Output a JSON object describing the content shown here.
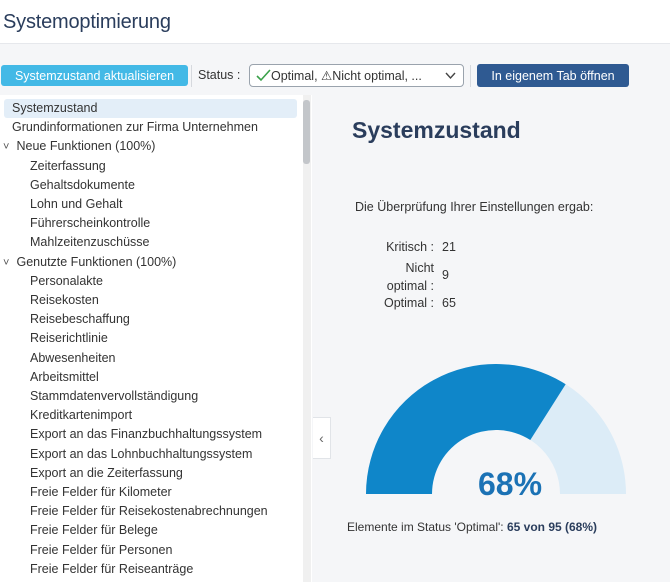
{
  "page": {
    "title": "Systemoptimierung"
  },
  "toolbar": {
    "refresh_label": "Systemzustand aktualisieren",
    "status_label": "Status :",
    "status_value": "Optimal, ⚠Nicht optimal, ...",
    "open_tab_label": "In eigenem Tab öffnen"
  },
  "sidebar": {
    "items": [
      {
        "label": "Systemzustand",
        "selected": true,
        "level": 0
      },
      {
        "label": "Grundinformationen zur Firma Unternehmen",
        "level": 0
      },
      {
        "label": "Neue Funktionen (100%)",
        "level": 0,
        "group": true
      },
      {
        "label": "Zeiterfassung",
        "level": 1
      },
      {
        "label": "Gehaltsdokumente",
        "level": 1
      },
      {
        "label": "Lohn und Gehalt",
        "level": 1
      },
      {
        "label": "Führerscheinkontrolle",
        "level": 1
      },
      {
        "label": "Mahlzeitenzuschüsse",
        "level": 1
      },
      {
        "label": "Genutzte Funktionen (100%)",
        "level": 0,
        "group": true
      },
      {
        "label": "Personalakte",
        "level": 1
      },
      {
        "label": "Reisekosten",
        "level": 1
      },
      {
        "label": "Reisebeschaffung",
        "level": 1
      },
      {
        "label": "Reiserichtlinie",
        "level": 1
      },
      {
        "label": "Abwesenheiten",
        "level": 1
      },
      {
        "label": "Arbeitsmittel",
        "level": 1
      },
      {
        "label": "Stammdatenvervollständigung",
        "level": 1
      },
      {
        "label": "Kreditkartenimport",
        "level": 1
      },
      {
        "label": "Export an das Finanzbuchhaltungssystem",
        "level": 1
      },
      {
        "label": "Export an das Lohnbuchhaltungssystem",
        "level": 1
      },
      {
        "label": "Export an die Zeiterfassung",
        "level": 1
      },
      {
        "label": "Freie Felder für Kilometer",
        "level": 1
      },
      {
        "label": "Freie Felder für Reisekostenabrechnungen",
        "level": 1
      },
      {
        "label": "Freie Felder für Belege",
        "level": 1
      },
      {
        "label": "Freie Felder für Personen",
        "level": 1
      },
      {
        "label": "Freie Felder für Reiseanträge",
        "level": 1
      }
    ]
  },
  "main": {
    "title": "Systemzustand",
    "intro": "Die Überprüfung Ihrer Einstellungen ergab:",
    "stats": [
      {
        "label": "Kritisch :",
        "value": "21"
      },
      {
        "label": "Nicht optimal :",
        "value": "9"
      },
      {
        "label": "Optimal :",
        "value": "65"
      }
    ],
    "gauge_percent_label": "68%",
    "gauge_fraction": 0.68,
    "summary_prefix": "Elemente im Status 'Optimal':",
    "summary_value": "65 von 95 (68%)"
  },
  "colors": {
    "gauge_fill": "#0f86c9",
    "gauge_track": "#dcecf7",
    "accent_button": "#43b9e6",
    "primary_button": "#2f5a92",
    "title": "#2a3d5c"
  },
  "icons": {
    "check": "check-icon",
    "warning": "warning-icon",
    "dropdown": "chevron-down-icon",
    "collapse": "chevron-left-icon",
    "group": "chevron-down-icon"
  }
}
